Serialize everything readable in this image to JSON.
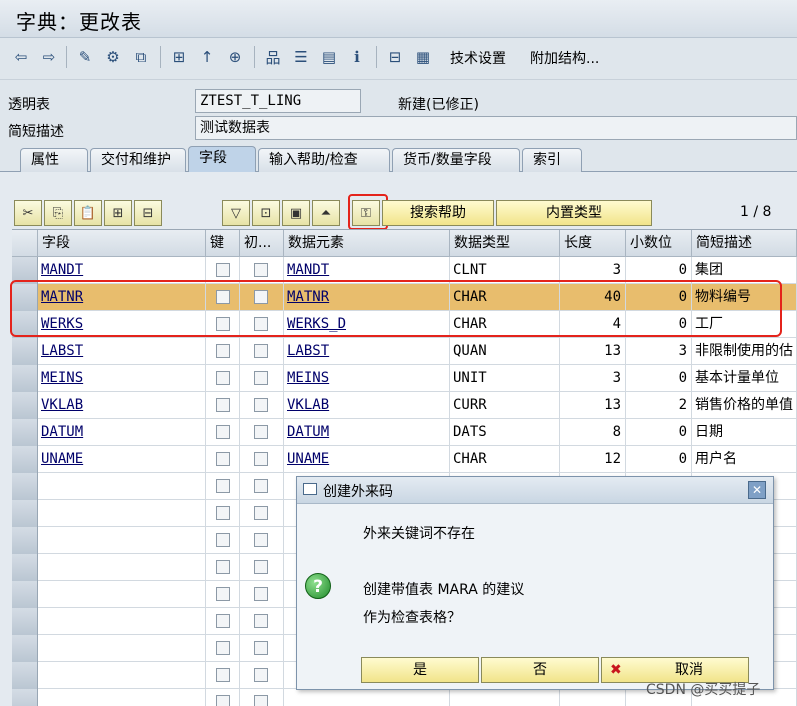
{
  "window": {
    "title": "字典：更改表"
  },
  "toolbar": {
    "tech_settings": "技术设置",
    "append_structure": "附加结构..."
  },
  "header": {
    "table_label": "透明表",
    "table_value": "ZTEST_T_LING",
    "status": "新建(已修正)",
    "desc_label": "简短描述",
    "desc_value": "测试数据表"
  },
  "tabs": [
    "属性",
    "交付和维护",
    "字段",
    "输入帮助/检查",
    "货币/数量字段",
    "索引"
  ],
  "active_tab": "字段",
  "grid_toolbar": {
    "search_help": "搜索帮助",
    "builtin_type": "内置类型",
    "pager": "1 / 8"
  },
  "grid": {
    "columns": [
      "字段",
      "键",
      "初...",
      "数据元素",
      "数据类型",
      "长度",
      "小数位",
      "简短描述"
    ],
    "rows": [
      {
        "field": "MANDT",
        "element": "MANDT",
        "type": "CLNT",
        "length": "3",
        "decimals": "0",
        "desc": "集团"
      },
      {
        "field": "MATNR",
        "element": "MATNR",
        "type": "CHAR",
        "length": "40",
        "decimals": "0",
        "desc": "物料编号"
      },
      {
        "field": "WERKS",
        "element": "WERKS_D",
        "type": "CHAR",
        "length": "4",
        "decimals": "0",
        "desc": "工厂"
      },
      {
        "field": "LABST",
        "element": "LABST",
        "type": "QUAN",
        "length": "13",
        "decimals": "3",
        "desc": "非限制使用的估"
      },
      {
        "field": "MEINS",
        "element": "MEINS",
        "type": "UNIT",
        "length": "3",
        "decimals": "0",
        "desc": "基本计量单位"
      },
      {
        "field": "VKLAB",
        "element": "VKLAB",
        "type": "CURR",
        "length": "13",
        "decimals": "2",
        "desc": "销售价格的单值"
      },
      {
        "field": "DATUM",
        "element": "DATUM",
        "type": "DATS",
        "length": "8",
        "decimals": "0",
        "desc": "日期"
      },
      {
        "field": "UNAME",
        "element": "UNAME",
        "type": "CHAR",
        "length": "12",
        "decimals": "0",
        "desc": "用户名"
      }
    ]
  },
  "dialog": {
    "title": "创建外来码",
    "line1": "外来关键词不存在",
    "line2": "创建带值表 MARA 的建议",
    "line3": "作为检查表格？",
    "yes": "是",
    "no": "否",
    "cancel": "取消"
  },
  "watermark": "CSDN @买买提子",
  "colors": {
    "selected_row": "#e8bd6d",
    "highlight_red": "#e4231b",
    "button_yellow": "#f1e48a"
  }
}
